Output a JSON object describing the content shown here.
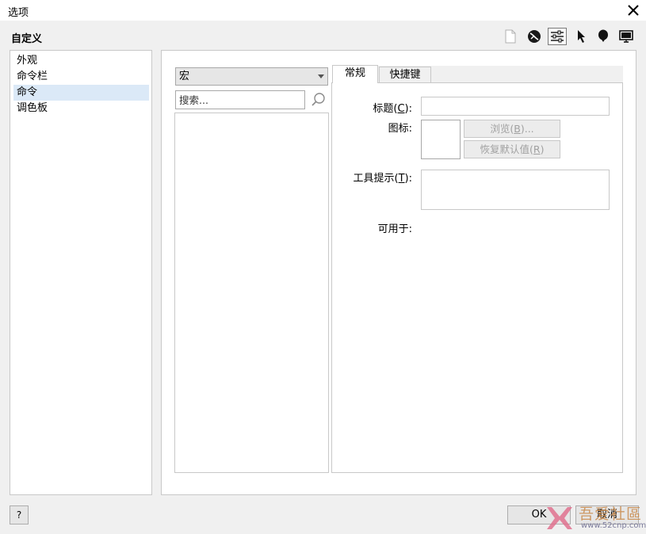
{
  "window": {
    "title": "选项"
  },
  "section_title": "自定义",
  "toolbar": {
    "icons": [
      "document-icon",
      "globe-icon",
      "sliders-icon",
      "pointer-icon",
      "balloon-icon",
      "monitor-icon"
    ]
  },
  "nav": {
    "items": [
      {
        "label": "外观"
      },
      {
        "label": "命令栏"
      },
      {
        "label": "命令"
      },
      {
        "label": "调色板"
      }
    ],
    "active_index": 2
  },
  "commands": {
    "category": "宏",
    "search_placeholder": "搜索..."
  },
  "tabs": [
    {
      "label": "常规"
    },
    {
      "label": "快捷键"
    }
  ],
  "general": {
    "caption_label": "标题",
    "caption_key": "C",
    "icon_label": "图标:",
    "browse_label": "浏览",
    "browse_key": "B",
    "restore_label": "恢复默认值",
    "restore_key": "R",
    "tooltip_label": "工具提示",
    "tooltip_key": "T",
    "available_label": "可用于:"
  },
  "footer": {
    "help_label": "?",
    "ok_label": "OK",
    "cancel_label": "取消"
  },
  "watermark": {
    "text": "吾爱社區",
    "url": "www.52cnp.com"
  },
  "colors": {
    "selection": "#dbe9f7",
    "watermark": "#c98a4b"
  }
}
